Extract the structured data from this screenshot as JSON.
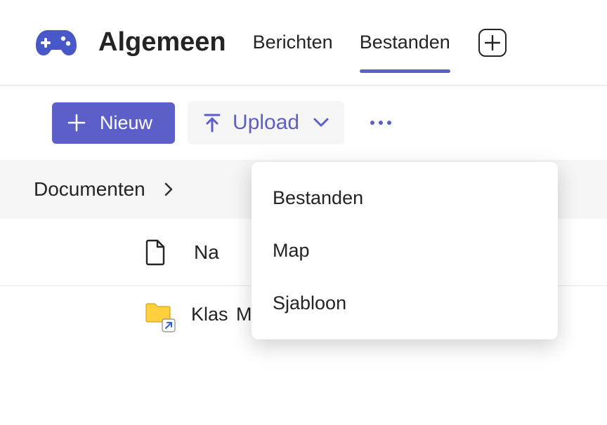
{
  "header": {
    "channel": "Algemeen",
    "tabs": [
      {
        "label": "Berichten",
        "active": false
      },
      {
        "label": "Bestanden",
        "active": true
      }
    ]
  },
  "toolbar": {
    "new_label": "Nieuw",
    "upload_label": "Upload"
  },
  "upload_menu": {
    "items": [
      {
        "label": "Bestanden"
      },
      {
        "label": "Map"
      },
      {
        "label": "Sjabloon"
      }
    ]
  },
  "breadcrumb": {
    "root": "Documenten"
  },
  "columns": {
    "name": "Na"
  },
  "rows": [
    {
      "name_part1": "Klas",
      "name_part2": "Materiaal"
    }
  ]
}
